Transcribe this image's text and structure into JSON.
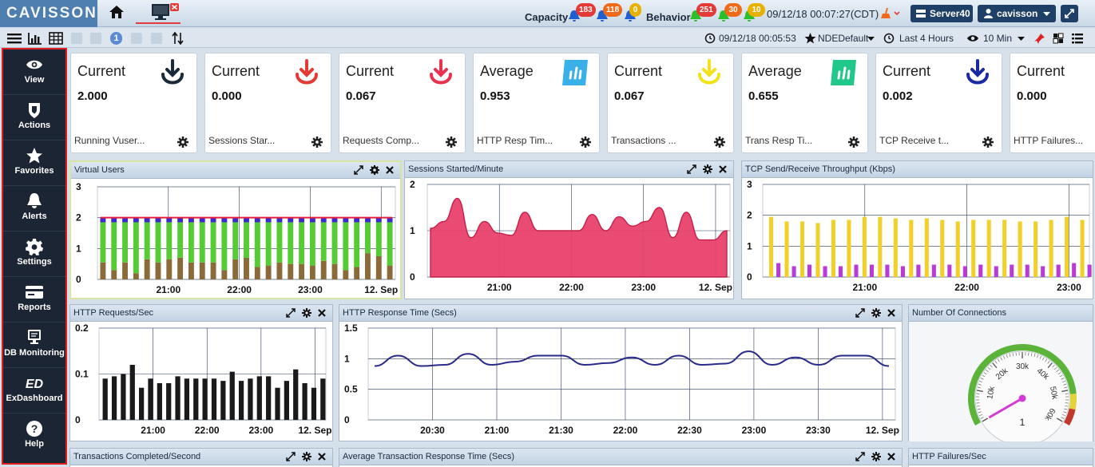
{
  "app": {
    "logo": "CAVISSON"
  },
  "topbar": {
    "capacity_label": "Capacity",
    "behavior_label": "Behavior",
    "capacity_badges": [
      "183",
      "118",
      "0"
    ],
    "behavior_badges": [
      "251",
      "30",
      "10"
    ],
    "datetime": "09/12/18 00:07:27(CDT)",
    "server_button": "Server40",
    "user_button": "cavisson"
  },
  "toolbar": {
    "page": "1",
    "time": "09/12/18 00:05:53",
    "favorite": "NDEDefault",
    "range": "Last 4 Hours",
    "interval": "10 Min"
  },
  "sidebar": {
    "items": [
      {
        "label": "View",
        "icon": "eye-icon"
      },
      {
        "label": "Actions",
        "icon": "shield-icon"
      },
      {
        "label": "Favorites",
        "icon": "star-icon"
      },
      {
        "label": "Alerts",
        "icon": "bell-icon"
      },
      {
        "label": "Settings",
        "icon": "gear-icon"
      },
      {
        "label": "Reports",
        "icon": "card-icon"
      },
      {
        "label": "DB Monitoring",
        "icon": "monitor-icon"
      },
      {
        "label": "ExDashboard",
        "icon": "ed-icon"
      },
      {
        "label": "Help",
        "icon": "help-icon"
      }
    ]
  },
  "kpis": [
    {
      "head": "Current",
      "value": "2.000",
      "name": "Running Vuser...",
      "icon": "download-icon",
      "color": "#1a2a3a"
    },
    {
      "head": "Current",
      "value": "0.000",
      "name": "Sessions Star...",
      "icon": "download-icon",
      "color": "#e53935"
    },
    {
      "head": "Current",
      "value": "0.067",
      "name": "Requests Comp...",
      "icon": "download-icon",
      "color": "#e8304f"
    },
    {
      "head": "Average",
      "value": "0.953",
      "name": "HTTP Resp Tim...",
      "icon": "bars-tile-icon",
      "color": "#3ab0e8"
    },
    {
      "head": "Current",
      "value": "0.067",
      "name": "Transactions ...",
      "icon": "download-icon",
      "color": "#f2e21a"
    },
    {
      "head": "Average",
      "value": "0.655",
      "name": "Trans Resp Ti...",
      "icon": "bars-tile-icon",
      "color": "#22c88a"
    },
    {
      "head": "Current",
      "value": "0.002",
      "name": "TCP Receive t...",
      "icon": "download-icon",
      "color": "#1a2aa0"
    },
    {
      "head": "Current",
      "value": "0.000",
      "name": "HTTP Failures...",
      "icon": "download-icon",
      "color": "#333333"
    }
  ],
  "panels": {
    "virtual_users": "Virtual Users",
    "sessions": "Sessions Started/Minute",
    "tcp": "TCP Send/Receive Throughput (Kbps)",
    "http_req": "HTTP Requests/Sec",
    "http_resp": "HTTP Response Time (Secs)",
    "connections": "Number Of Connections",
    "trans_completed": "Transactions Completed/Second",
    "avg_trans_resp": "Average Transaction Response Time (Secs)",
    "http_failures": "HTTP Failures/Sec"
  },
  "chart_data": [
    {
      "type": "bar",
      "title": "Virtual Users",
      "ylim": [
        0,
        3
      ],
      "yticks": [
        "3",
        "2",
        "1",
        "0"
      ],
      "xticks": [
        "21:00",
        "22:00",
        "23:00",
        "12. Sep"
      ],
      "series": [
        {
          "color": "#8b6a3a",
          "values": [
            0.55,
            0.3,
            0.55,
            0.2,
            0.65,
            0.55,
            0.65,
            0.7,
            0.55,
            0.55,
            0.55,
            0.3,
            0.65,
            0.7,
            0.4,
            0.45,
            0.55,
            0.5,
            0.5,
            0.45,
            0.6,
            0.5,
            0.3,
            0.4,
            0.85,
            0.75,
            0.45
          ]
        },
        {
          "color": "#55cc33",
          "values": [
            1.3,
            1.55,
            1.3,
            1.65,
            1.2,
            1.3,
            1.2,
            1.15,
            1.3,
            1.3,
            1.3,
            1.55,
            1.2,
            1.15,
            1.45,
            1.4,
            1.3,
            1.35,
            1.35,
            1.4,
            1.25,
            1.35,
            1.55,
            1.45,
            1.0,
            1.1,
            1.4
          ]
        },
        {
          "color": "#3a2ad0",
          "values": [
            0.15,
            0.15,
            0.15,
            0.15,
            0.15,
            0.15,
            0.15,
            0.15,
            0.15,
            0.15,
            0.15,
            0.15,
            0.15,
            0.15,
            0.15,
            0.15,
            0.15,
            0.15,
            0.15,
            0.15,
            0.15,
            0.15,
            0.15,
            0.15,
            0.15,
            0.15,
            0.15
          ]
        }
      ],
      "line": {
        "color": "#e0203a",
        "value": 2.0
      }
    },
    {
      "type": "area",
      "title": "Sessions Started/Minute",
      "ylim": [
        0,
        2
      ],
      "yticks": [
        "2",
        "1",
        "0"
      ],
      "xticks": [
        "21:00",
        "22:00",
        "23:00",
        "12. Sep"
      ],
      "color": "#e8416a",
      "values": [
        1.05,
        1.2,
        1.7,
        0.85,
        1.2,
        0.95,
        0.9,
        1.4,
        1.0,
        1.0,
        1.0,
        1.0,
        1.35,
        1.0,
        1.3,
        1.1,
        1.2,
        1.5,
        0.85,
        1.4,
        0.8,
        0.8,
        1.0
      ]
    },
    {
      "type": "bar",
      "title": "TCP Send/Receive Throughput (Kbps)",
      "ylim": [
        0,
        3
      ],
      "yticks": [
        "3",
        "2",
        "1",
        "0"
      ],
      "xticks": [
        "21:00",
        "22:00",
        "23:00"
      ],
      "series": [
        {
          "color": "#f2d02a",
          "values": [
            1.95,
            1.8,
            1.8,
            1.75,
            1.85,
            1.85,
            1.95,
            1.95,
            1.9,
            1.85,
            1.9,
            1.85,
            1.8,
            1.85,
            1.85,
            1.85,
            1.8,
            1.8,
            1.85,
            1.95,
            1.85
          ]
        },
        {
          "color": "#b93ad6",
          "values": [
            0.45,
            0.35,
            0.4,
            0.35,
            0.35,
            0.4,
            0.4,
            0.4,
            0.35,
            0.4,
            0.4,
            0.4,
            0.35,
            0.4,
            0.35,
            0.4,
            0.4,
            0.35,
            0.4,
            0.45,
            0.4
          ]
        }
      ]
    },
    {
      "type": "bar",
      "title": "HTTP Requests/Sec",
      "ylim": [
        0,
        0.2
      ],
      "yticks": [
        "0.2",
        "0.1",
        "0"
      ],
      "xticks": [
        "21:00",
        "22:00",
        "23:00",
        "12. Sep"
      ],
      "color": "#1a1a1a",
      "values": [
        0.09,
        0.095,
        0.1,
        0.12,
        0.07,
        0.09,
        0.08,
        0.08,
        0.095,
        0.09,
        0.09,
        0.09,
        0.09,
        0.085,
        0.105,
        0.085,
        0.09,
        0.095,
        0.095,
        0.07,
        0.085,
        0.11,
        0.08,
        0.07,
        0.09
      ]
    },
    {
      "type": "line",
      "title": "HTTP Response Time (Secs)",
      "ylim": [
        0,
        1.5
      ],
      "yticks": [
        "1.5",
        "1",
        "0.5",
        "0"
      ],
      "xticks": [
        "20:30",
        "21:00",
        "21:30",
        "22:00",
        "22:30",
        "23:00",
        "23:30",
        "12. Sep"
      ],
      "color": "#2a2a8a",
      "values": [
        0.88,
        1.05,
        0.88,
        0.9,
        1.08,
        0.9,
        0.95,
        1.05,
        1.05,
        0.9,
        0.93,
        1.02,
        0.9,
        1.05,
        0.9,
        0.92,
        1.12,
        0.9,
        1.02,
        0.9,
        1.05,
        1.05,
        0.88
      ]
    },
    {
      "type": "gauge",
      "title": "Number Of Connections",
      "ticks": [
        "10k",
        "20k",
        "30k",
        "40k",
        "50k",
        "60k"
      ],
      "value": 1,
      "value_label": "1"
    }
  ]
}
